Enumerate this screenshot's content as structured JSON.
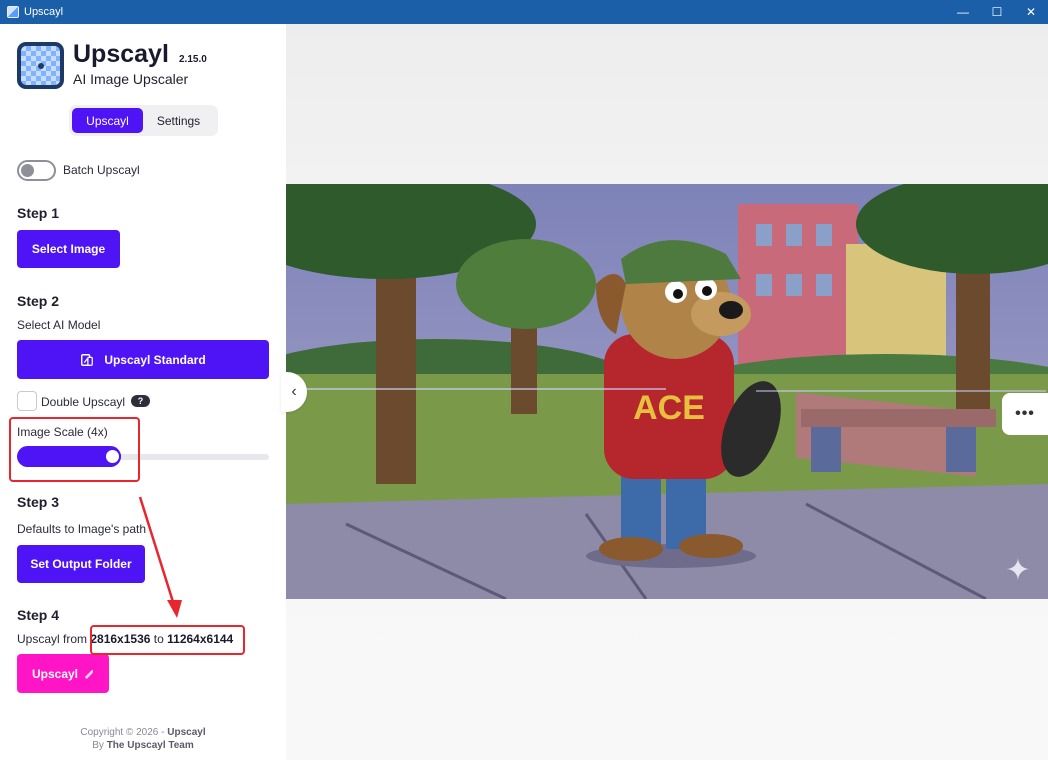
{
  "window": {
    "title": "Upscayl",
    "controls": {
      "minimize": "—",
      "maximize": "☐",
      "close": "✕"
    }
  },
  "brand": {
    "name": "Upscayl",
    "version": "2.15.0",
    "tagline": "AI Image Upscaler"
  },
  "tabs": [
    {
      "label": "Upscayl",
      "active": true
    },
    {
      "label": "Settings",
      "active": false
    }
  ],
  "batch": {
    "label": "Batch Upscayl",
    "enabled": false
  },
  "step1": {
    "title": "Step 1",
    "button": "Select Image"
  },
  "step2": {
    "title": "Step 2",
    "subtitle": "Select AI Model",
    "model_button": "Upscayl Standard",
    "double_label": "Double Upscayl",
    "double_checked": false,
    "help": "?"
  },
  "scale": {
    "label": "Image Scale (4x)",
    "value": 4,
    "min": 1,
    "max": 16
  },
  "step3": {
    "title": "Step 3",
    "subtitle": "Defaults to Image's path",
    "button": "Set Output Folder"
  },
  "step4": {
    "title": "Step 4",
    "prefix": "Upscayl from",
    "from": "2816x1536",
    "to_word": "to",
    "to": "11264x6144",
    "button": "Upscayl"
  },
  "footer": {
    "copyright": "Copyright © 2026 -",
    "brand": "Upscayl",
    "by": "By",
    "team": "The Upscayl Team"
  },
  "preview": {
    "nav_left": "‹",
    "more": "•••",
    "sparkle": "✦",
    "jersey_text": "ACE"
  },
  "colors": {
    "titlebar": "#1b5fa8",
    "accent": "#4f14f5",
    "upscayl_button": "#ff14c6",
    "annotation": "#e8262e"
  }
}
